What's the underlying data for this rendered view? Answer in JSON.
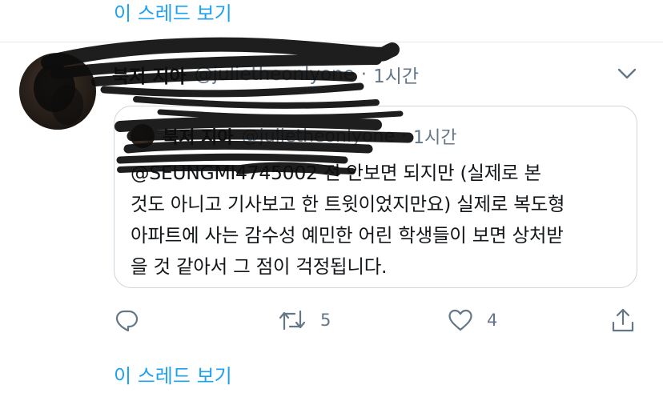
{
  "thread": {
    "top_link": "이 스레드 보기",
    "bottom_link": "이 스레드 보기"
  },
  "tweet": {
    "author_name": "북저 지아",
    "author_handle": "@julietheonlyone",
    "separator": "·",
    "time": "1시간",
    "quoted": {
      "author_name": "북저 지아",
      "author_handle": "@julietheonlyone",
      "separator": "·",
      "time": "1시간",
      "text": "@SEUNGMI4745002 전 안보면 되지만 (실제로 본\n것도 아니고 기사보고 한 트윗이었지만요) 실제로 복도형\n아파트에 사는 감수성 예민한 어린 학생들이 보면 상처받\n을 것 같아서 그 점이 걱정됩니다."
    },
    "actions": {
      "reply_count": "",
      "retweet_count": "5",
      "like_count": "4"
    }
  },
  "colors": {
    "link": "#1da1f2",
    "secondary_text": "#657786",
    "border": "#ccd6dd",
    "redaction": "#0d0d0d"
  },
  "icons": [
    "reply-icon",
    "retweet-icon",
    "like-icon",
    "share-icon",
    "chevron-down-icon"
  ]
}
